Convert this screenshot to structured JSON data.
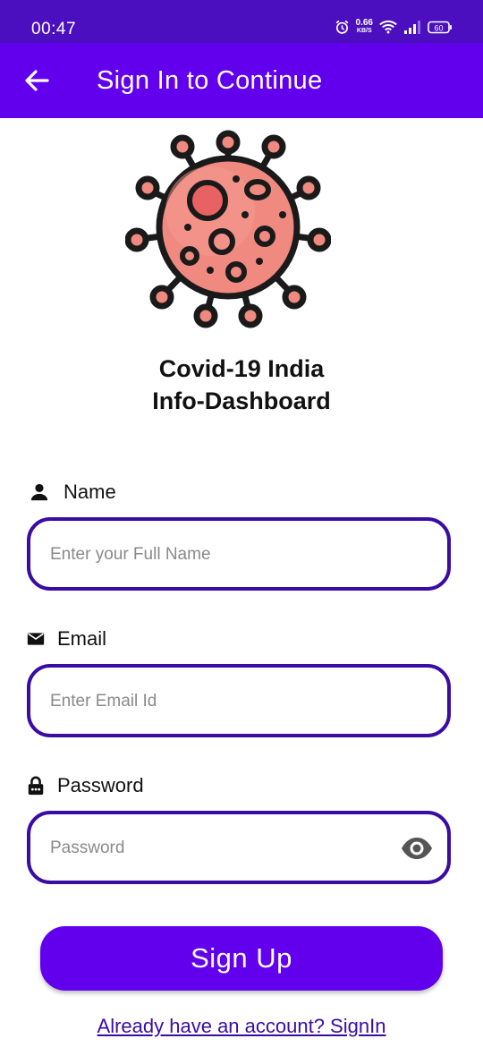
{
  "status_bar": {
    "time": "00:47",
    "net_speed": "0.66",
    "net_unit": "KB/S",
    "battery": "60",
    "icons": [
      "alarm-icon",
      "wifi-icon",
      "signal-icon",
      "battery-icon"
    ]
  },
  "app_bar": {
    "title": "Sign In to Continue",
    "back_icon": "arrow-left-icon"
  },
  "logo": {
    "icon": "virus-icon"
  },
  "app_name": {
    "line1": "Covid-19 India",
    "line2": "Info-Dashboard"
  },
  "form": {
    "name": {
      "label": "Name",
      "icon": "person-icon",
      "placeholder": "Enter your Full Name",
      "value": ""
    },
    "email": {
      "label": "Email",
      "icon": "mail-icon",
      "placeholder": "Enter Email Id",
      "value": ""
    },
    "password": {
      "label": "Password",
      "icon": "lock-icon",
      "placeholder": "Password",
      "value": "",
      "toggle_icon": "eye-icon"
    }
  },
  "signup_button": "Sign Up",
  "signin_link": "Already have an account? SignIn",
  "colors": {
    "status_bar": "#4b0fbf",
    "primary": "#6200ee",
    "input_border": "#3a0ca3",
    "virus_fill": "#f08a80",
    "virus_dark": "#e86262"
  }
}
